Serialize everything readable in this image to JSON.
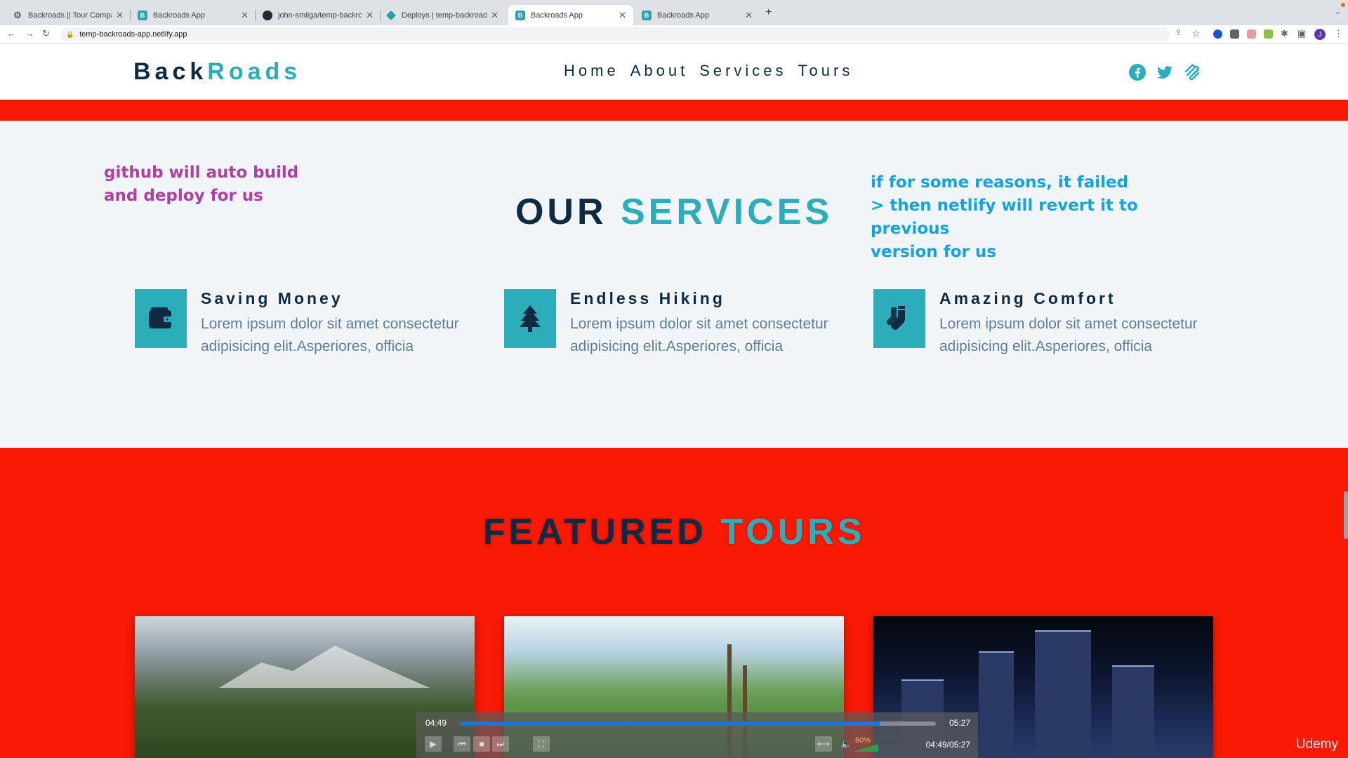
{
  "browser": {
    "tabs": [
      {
        "title": "Backroads || Tour Company"
      },
      {
        "title": "Backroads App"
      },
      {
        "title": "john-smilga/temp-backroads-a"
      },
      {
        "title": "Deploys | temp-backroads-app"
      },
      {
        "title": "Backroads App"
      },
      {
        "title": "Backroads App"
      }
    ],
    "active_tab_index": 4,
    "url": "temp-backroads-app.netlify.app",
    "profile_initial": "J"
  },
  "site": {
    "logo_part1": "Back",
    "logo_part2": "Roads",
    "nav": [
      "Home",
      "About",
      "Services",
      "Tours"
    ],
    "social_icons": [
      "facebook-icon",
      "twitter-icon",
      "squarespace-icon"
    ],
    "accent_color": "#2caeba",
    "dark_color": "#102a42"
  },
  "annotations": {
    "left_note": [
      "github will auto build",
      "and deploy for us"
    ],
    "right_note": [
      "if for some reasons, it failed",
      "> then netlify will revert it to previous",
      "version for us"
    ]
  },
  "services": {
    "title_part1": "OUR",
    "title_part2": "SERVICES",
    "items": [
      {
        "title": "Saving Money",
        "text": "Lorem ipsum dolor sit amet consectetur adipisicing elit.Asperiores, officia",
        "icon": "wallet-icon"
      },
      {
        "title": "Endless Hiking",
        "text": "Lorem ipsum dolor sit amet consectetur adipisicing elit.Asperiores, officia",
        "icon": "tree-icon"
      },
      {
        "title": "Amazing Comfort",
        "text": "Lorem ipsum dolor sit amet consectetur adipisicing elit.Asperiores, officia",
        "icon": "socks-icon"
      }
    ]
  },
  "tours": {
    "title_part1": "FEATURED",
    "title_part2": "TOURS"
  },
  "player": {
    "current": "04:49",
    "total": "05:27",
    "combined": "04:49/05:27",
    "volume": "60%",
    "progress_fraction": 0.883,
    "watermark": "Udemy"
  }
}
